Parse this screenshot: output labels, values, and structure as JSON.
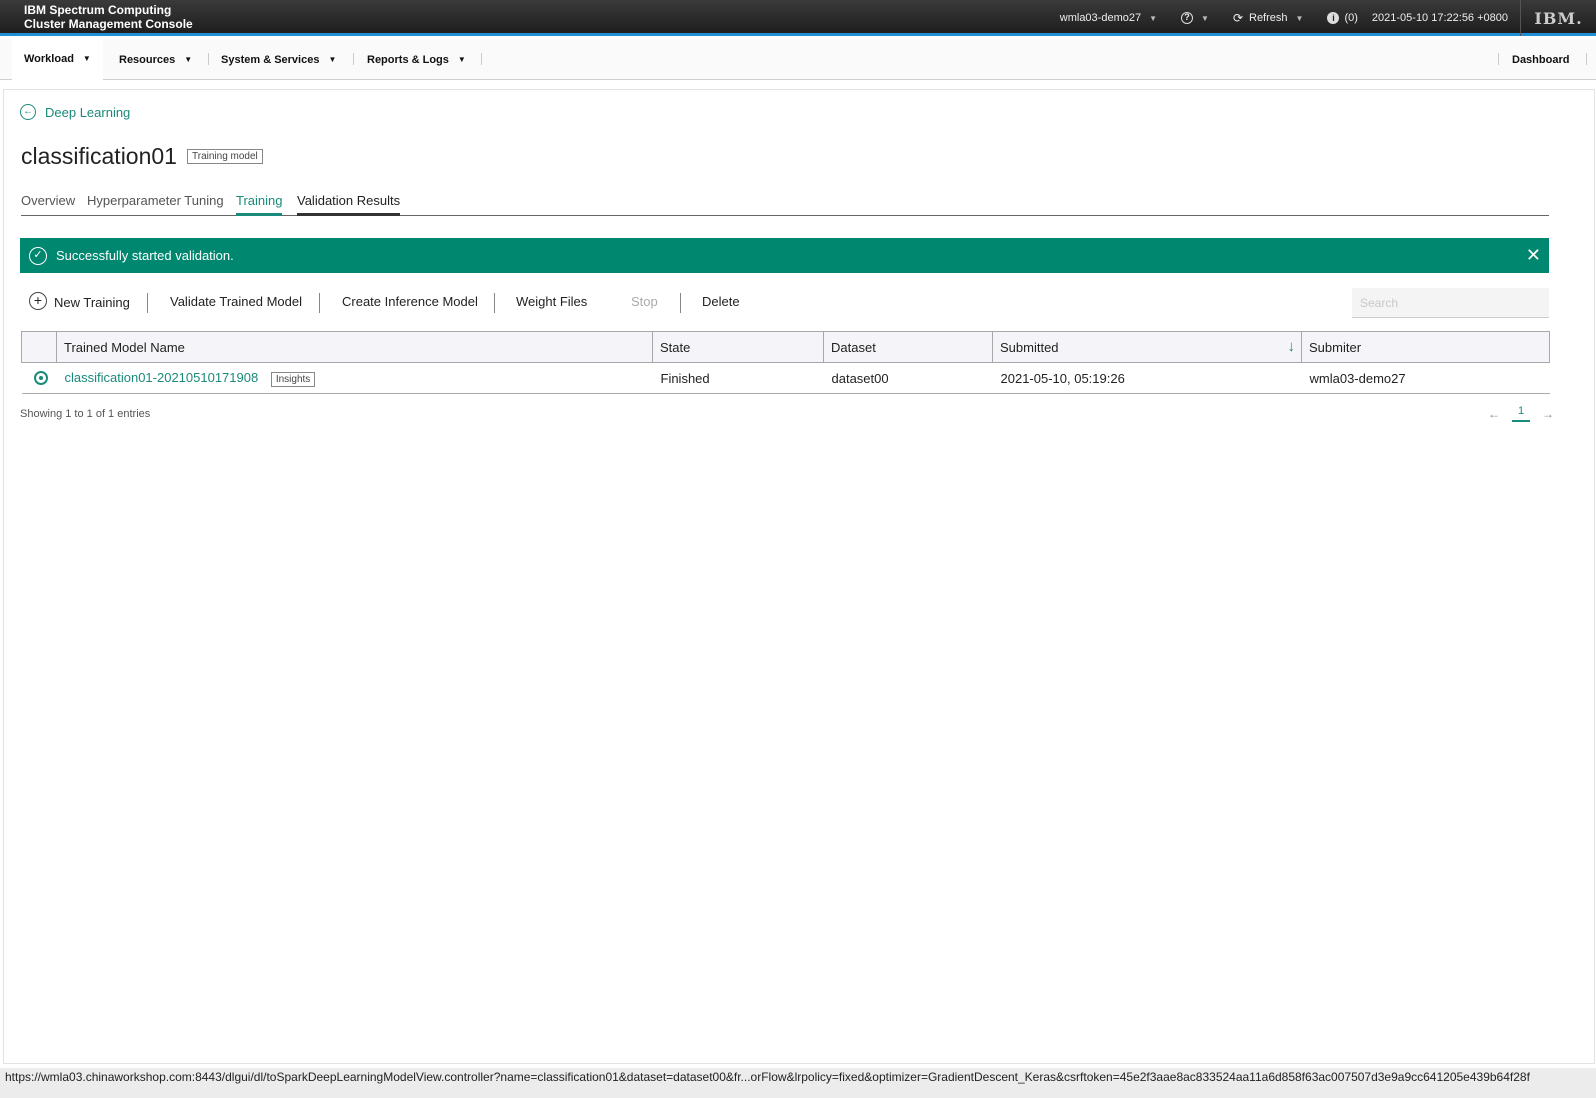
{
  "header": {
    "brand_line1": "IBM Spectrum Computing",
    "brand_line2": "Cluster Management Console",
    "user": "wmla03-demo27",
    "help_icon": "?",
    "refresh_label": "Refresh",
    "info_count": "(0)",
    "datetime": "2021-05-10 17:22:56 +0800",
    "logo": "IBM."
  },
  "nav": {
    "items": [
      {
        "label": "Workload"
      },
      {
        "label": "Resources"
      },
      {
        "label": "System & Services"
      },
      {
        "label": "Reports & Logs"
      }
    ],
    "dashboard": "Dashboard"
  },
  "breadcrumb": {
    "back_label": "Deep Learning"
  },
  "page": {
    "title": "classification01",
    "tag": "Training model"
  },
  "tabs": [
    {
      "label": "Overview"
    },
    {
      "label": "Hyperparameter Tuning"
    },
    {
      "label": "Training"
    },
    {
      "label": "Validation Results"
    }
  ],
  "alert": {
    "message": "Successfully started validation."
  },
  "toolbar": {
    "new_training": "New Training",
    "validate": "Validate Trained Model",
    "create_inference": "Create Inference Model",
    "weight_files": "Weight Files",
    "stop": "Stop",
    "delete": "Delete"
  },
  "search": {
    "placeholder": "Search"
  },
  "table": {
    "columns": [
      "Trained Model Name",
      "State",
      "Dataset",
      "Submitted",
      "Submiter"
    ],
    "rows": [
      {
        "name": "classification01-20210510171908",
        "badge": "Insights",
        "state": "Finished",
        "dataset": "dataset00",
        "submitted": "2021-05-10, 05:19:26",
        "submitter": "wmla03-demo27"
      }
    ]
  },
  "footer": {
    "showing": "Showing 1 to 1 of 1 entries",
    "prev": "←",
    "page": "1",
    "next": "→"
  },
  "statusbar": {
    "url": "https://wmla03.chinaworkshop.com:8443/dlgui/dl/toSparkDeepLearningModelView.controller?name=classification01&dataset=dataset00&fr...orFlow&lrpolicy=fixed&optimizer=GradientDescent_Keras&csrftoken=45e2f3aae8ac833524aa11a6d858f63ac007507d3e9a9cc641205e439b64f28f"
  },
  "colors": {
    "accent": "#1a8a7a",
    "alert_bg": "#00876f",
    "header_bg": "#262626",
    "header_rule": "#1f8fd6"
  }
}
